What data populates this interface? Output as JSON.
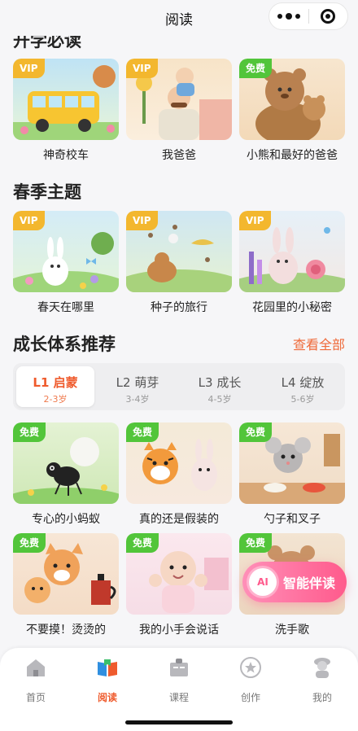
{
  "nav": {
    "title": "阅读"
  },
  "sections": {
    "must_read": {
      "title": "开学必读",
      "books": [
        {
          "title": "神奇校车",
          "badge": "VIP"
        },
        {
          "title": "我爸爸",
          "badge": "VIP"
        },
        {
          "title": "小熊和最好的爸爸",
          "badge": "免费"
        }
      ]
    },
    "spring": {
      "title": "春季主题",
      "books": [
        {
          "title": "春天在哪里",
          "badge": "VIP"
        },
        {
          "title": "种子的旅行",
          "badge": "VIP"
        },
        {
          "title": "花园里的小秘密",
          "badge": "VIP"
        }
      ]
    },
    "growth": {
      "title": "成长体系推荐",
      "see_all": "查看全部",
      "levels": [
        {
          "name": "L1 启蒙",
          "age": "2-3岁",
          "active": true
        },
        {
          "name": "L2 萌芽",
          "age": "3-4岁",
          "active": false
        },
        {
          "name": "L3 成长",
          "age": "4-5岁",
          "active": false
        },
        {
          "name": "L4 绽放",
          "age": "5-6岁",
          "active": false
        }
      ],
      "books": [
        {
          "title": "专心的小蚂蚁",
          "badge": "免费"
        },
        {
          "title": "真的还是假装的",
          "badge": "免费"
        },
        {
          "title": "勺子和叉子",
          "badge": "免费"
        },
        {
          "title": "不要摸！烫烫的",
          "badge": "免费"
        },
        {
          "title": "我的小手会说话",
          "badge": "免费"
        },
        {
          "title": "洗手歌",
          "badge": "免费"
        }
      ]
    }
  },
  "ai_button": {
    "icon_text": "AI",
    "label": "智能伴读"
  },
  "tabbar": [
    {
      "label": "首页",
      "icon": "home-icon"
    },
    {
      "label": "阅读",
      "icon": "book-icon",
      "active": true
    },
    {
      "label": "课程",
      "icon": "course-icon"
    },
    {
      "label": "创作",
      "icon": "star-icon"
    },
    {
      "label": "我的",
      "icon": "profile-icon"
    }
  ],
  "colors": {
    "accent": "#ef5b2d",
    "vip": "#f3b72e",
    "free": "#52c53a",
    "ai": "#ff5a8c"
  }
}
